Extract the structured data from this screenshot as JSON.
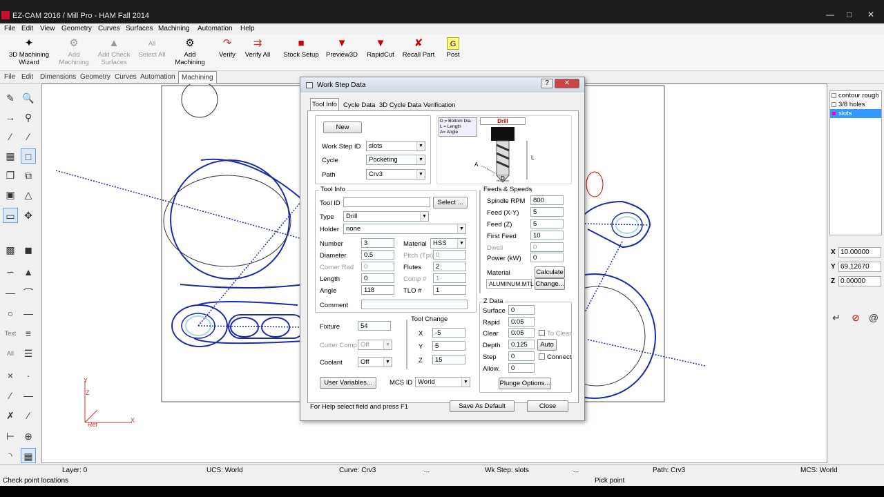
{
  "window": {
    "title": "EZ-CAM 2016 / Mill Pro  - HAM Fall 2014"
  },
  "menu": [
    "File",
    "Edit",
    "View",
    "Geometry",
    "Curves",
    "Surfaces",
    "Machining",
    "Automation",
    "Help"
  ],
  "toolbar": {
    "wizard": "3D Machining Wizard",
    "add_machining": "Add Machining",
    "add_check": "Add Check Surfaces",
    "all_label": "All",
    "select_all": "Select All",
    "add_machining2": "Add Machining",
    "verify": "Verify",
    "verify_all": "Verify All",
    "stock_setup": "Stock Setup",
    "preview3d": "Preview3D",
    "rapidcut": "RapidCut",
    "recall_part": "Recall Part",
    "post": "Post"
  },
  "tabs": [
    "File",
    "Edit",
    "Dimensions",
    "Geometry",
    "Curves",
    "Automation",
    "Machining"
  ],
  "left_text": {
    "text": "Text",
    "all": "All"
  },
  "tree": [
    "contour rough",
    "3/8 holes",
    "slots"
  ],
  "coords": {
    "x_label": "X",
    "x": "10.00000",
    "y_label": "Y",
    "y": "69.12670",
    "z_label": "Z",
    "z": "0.00000"
  },
  "axis": {
    "y": "Y",
    "z": "Z",
    "x": "X",
    "ref": "Ref"
  },
  "status": {
    "layer": "Layer: 0",
    "ucs": "UCS: World",
    "curve": "Curve: Crv3",
    "dots": "...",
    "wkstep": "Wk Step: slots",
    "dots2": "...",
    "path": "Path: Crv3",
    "mcs": "MCS: World",
    "hint": "Check point locations",
    "pick": "Pick point"
  },
  "dialog": {
    "title": "Work Step Data",
    "help": "?",
    "tabs": [
      "Tool Info",
      "Cycle Data",
      "3D Cycle Data",
      "Verification"
    ],
    "new": "New",
    "ws_id_label": "Work Step ID",
    "ws_id": "slots",
    "cycle_label": "Cycle",
    "cycle": "Pocketing",
    "path_label": "Path",
    "path": "Crv3",
    "legend_d": "D = Bottom Dia.",
    "legend_l": "L = Length",
    "legend_a": "A= Angle",
    "drill_label": "Drill",
    "a_lbl": "A",
    "l_lbl": "L",
    "d_lbl": "D",
    "toolinfo_title": "Tool Info",
    "tool_id_label": "Tool ID",
    "tool_id": "",
    "select": "Select ...",
    "type_label": "Type",
    "type": "Drill",
    "holder_label": "Holder",
    "holder": "none",
    "number_label": "Number",
    "number": "3",
    "material_label": "Material",
    "material": "HSS",
    "diameter_label": "Diameter",
    "diameter": "0.5",
    "pitch_label": "Pitch (Tpi)",
    "pitch": "0",
    "corner_label": "Corner Rad",
    "corner": "0",
    "flutes_label": "Flutes",
    "flutes": "2",
    "length_label": "Length",
    "length": "0",
    "comp_label": "Comp #",
    "comp": "1",
    "angle_label": "Angle",
    "angle": "118",
    "tlo_label": "TLO #",
    "tlo": "1",
    "comment_label": "Comment",
    "comment": "",
    "fixture_label": "Fixture",
    "fixture": "54",
    "cutter_label": "Cutter Comp",
    "cutter": "Off",
    "coolant_label": "Coolant",
    "coolant": "Off",
    "toolchange_title": "Tool Change",
    "tc_x_label": "X",
    "tc_x": "-5",
    "tc_y_label": "Y",
    "tc_y": "5",
    "tc_z_label": "Z",
    "tc_z": "15",
    "user_vars": "User Variables...",
    "mcs_label": "MCS ID",
    "mcs": "World",
    "fs_title": "Feeds & Speeds",
    "rpm_label": "Spindle RPM",
    "rpm": "800",
    "feedxy_label": "Feed (X-Y)",
    "feedxy": "5",
    "feedz_label": "Feed (Z)",
    "feedz": "5",
    "first_label": "First Feed",
    "first": "10",
    "dwell_label": "Dwell",
    "dwell": "0",
    "power_label": "Power (kW)",
    "power": "0",
    "mat_label": "Material",
    "calculate": "Calculate",
    "mat_file": "ALUMINUM.MTL",
    "change": "Change...",
    "z_title": "Z Data",
    "surface_label": "Surface",
    "surface": "0",
    "rapid_label": "Rapid",
    "rapid": "0.05",
    "clear_label": "Clear",
    "clear": "0.05",
    "to_clear": "To Clear",
    "depth_label": "Depth",
    "depth": "0.125",
    "auto": "Auto",
    "step_label": "Step",
    "step": "0",
    "connect": "Connect",
    "allow_label": "Allow.",
    "allow": "0",
    "plunge": "Plunge Options...",
    "help_text": "For Help select field and press F1",
    "save_default": "Save As Default",
    "close": "Close"
  },
  "colors": {
    "curve": "#1a2aa8",
    "selected": "#3399ff",
    "highlight": "#a8d8f0"
  }
}
